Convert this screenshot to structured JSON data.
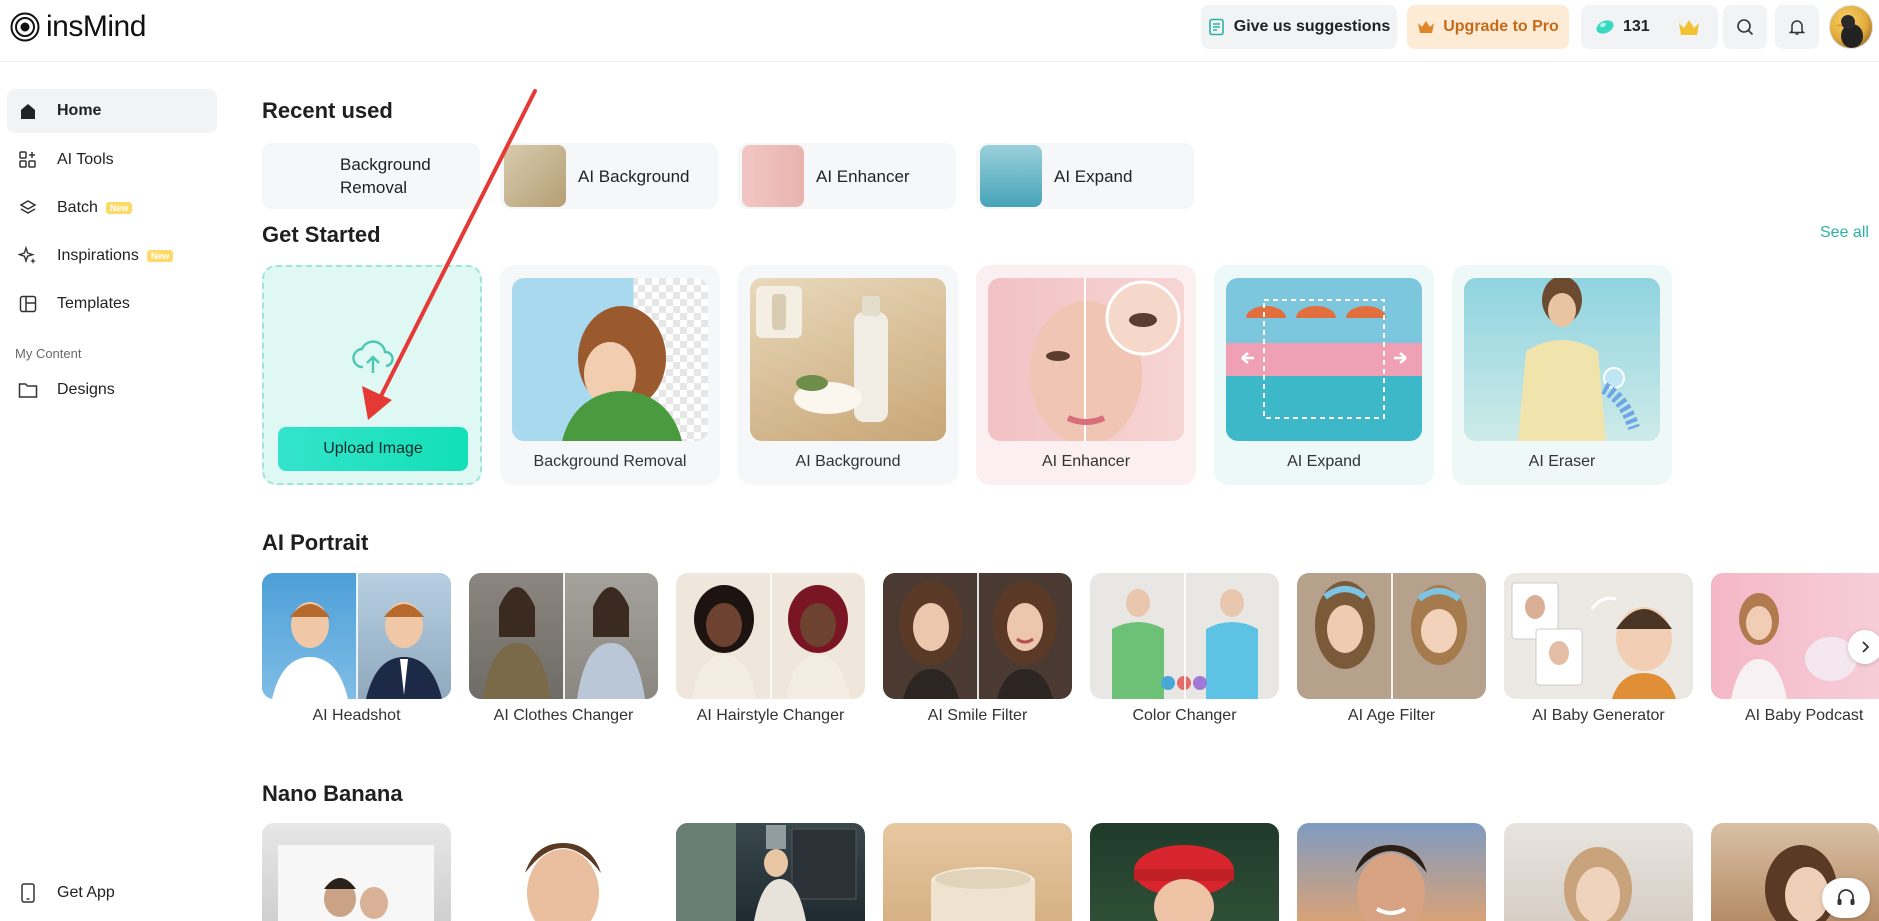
{
  "header": {
    "logo_text": "insMind",
    "suggest_label": "Give us suggestions",
    "upgrade_label": "Upgrade to Pro",
    "credits_count": "131",
    "icons": {
      "suggest": "edit-note-icon",
      "upgrade": "crown-icon",
      "credits": "gem-icon",
      "credits_crown": "crown-icon",
      "search": "search-icon",
      "bell": "bell-icon"
    }
  },
  "sidebar": {
    "items": [
      {
        "label": "Home",
        "icon": "home-icon",
        "active": true
      },
      {
        "label": "AI Tools",
        "icon": "grid-plus-icon"
      },
      {
        "label": "Batch",
        "icon": "layers-icon",
        "badge": "New"
      },
      {
        "label": "Inspirations",
        "icon": "sparkle-icon",
        "badge": "New"
      },
      {
        "label": "Templates",
        "icon": "template-icon"
      }
    ],
    "my_content_label": "My Content",
    "designs_label": "Designs",
    "get_app_label": "Get App"
  },
  "recent": {
    "title": "Recent used",
    "items": [
      "Background Removal",
      "AI Background",
      "AI Enhancer",
      "AI Expand"
    ]
  },
  "get_started": {
    "title": "Get Started",
    "see_all": "See all",
    "upload_label": "Upload Image",
    "cards": [
      "Background Removal",
      "AI Background",
      "AI Enhancer",
      "AI Expand",
      "AI Eraser"
    ]
  },
  "ai_portrait": {
    "title": "AI Portrait",
    "cards": [
      "AI Headshot",
      "AI Clothes Changer",
      "AI Hairstyle Changer",
      "AI Smile Filter",
      "Color Changer",
      "AI Age Filter",
      "AI Baby Generator",
      "AI Baby Podcast"
    ]
  },
  "nano_banana": {
    "title": "Nano Banana"
  },
  "colors": {
    "accent": "#2ab3a3",
    "upload_bg": "#dff8f3",
    "arrow": "#e53935"
  }
}
